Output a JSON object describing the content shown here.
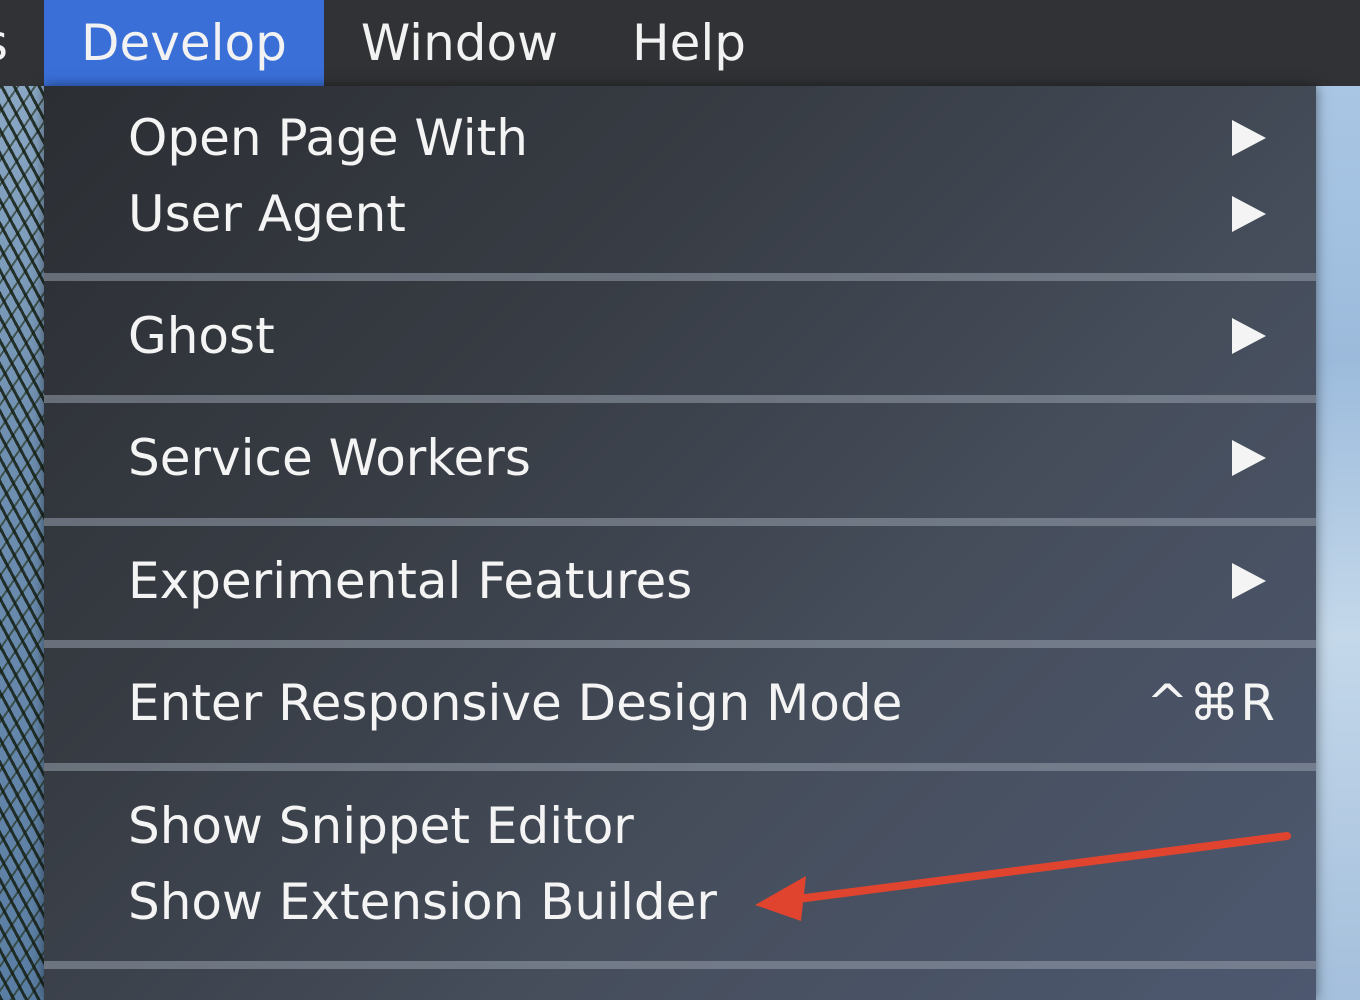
{
  "menubar": {
    "items": [
      {
        "label": "s"
      },
      {
        "label": "Develop"
      },
      {
        "label": "Window"
      },
      {
        "label": "Help"
      }
    ]
  },
  "menu": {
    "open_page_with": "Open Page With",
    "user_agent": "User Agent",
    "ghost": "Ghost",
    "service_workers": "Service Workers",
    "experimental_features": "Experimental Features",
    "responsive_design_mode": "Enter Responsive Design Mode",
    "responsive_design_mode_shortcut": "^⌘R",
    "show_snippet_editor": "Show Snippet Editor",
    "show_extension_builder": "Show Extension Builder"
  },
  "colors": {
    "menubar": "#303236",
    "active_menu": "#3a6fd8",
    "annotation_arrow": "#e0442f"
  }
}
